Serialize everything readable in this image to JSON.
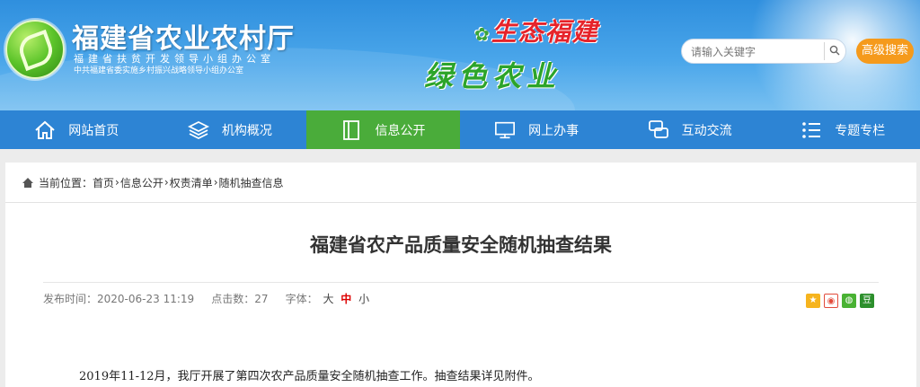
{
  "header": {
    "site_title": "福建省农业农村厅",
    "subtitle_1": "福建省扶贫开发领导小组办公室",
    "subtitle_2": "中共福建省委实施乡村振兴战略领导小组办公室",
    "slogan_line1": "生态福建",
    "slogan_line2": "绿色农业",
    "search_placeholder": "请输入关键字",
    "advanced_search_label": "高级搜索"
  },
  "nav": {
    "items": [
      {
        "label": "网站首页",
        "icon": "home-icon"
      },
      {
        "label": "机构概况",
        "icon": "layers-icon"
      },
      {
        "label": "信息公开",
        "icon": "book-icon",
        "active": true
      },
      {
        "label": "网上办事",
        "icon": "monitor-icon"
      },
      {
        "label": "互动交流",
        "icon": "chat-icon"
      },
      {
        "label": "专题专栏",
        "icon": "list-icon"
      }
    ]
  },
  "breadcrumb": {
    "prefix": "当前位置：",
    "items": [
      "首页",
      "信息公开",
      "权责清单",
      "随机抽查信息"
    ],
    "separator": "›"
  },
  "article": {
    "title": "福建省农产品质量安全随机抽查结果",
    "publish_label": "发布时间：",
    "publish_time": "2020-06-23 11:19",
    "clicks_label": "点击数：",
    "clicks": "27",
    "font_label": "字体：",
    "font_large": "大",
    "font_medium": "中",
    "font_small": "小",
    "body": "2019年11-12月，我厅开展了第四次农产品质量安全随机抽查工作。抽查结果详见附件。"
  },
  "share": {
    "icons": [
      "qzone-icon",
      "weibo-icon",
      "wechat-icon",
      "douban-icon"
    ],
    "douban_glyph": "豆"
  },
  "colors": {
    "nav_bg": "#2d84d4",
    "nav_active": "#4aac3a",
    "advanced_btn": "#f59a1c",
    "slogan_red": "#e6232a",
    "slogan_green": "#2ca42a"
  }
}
